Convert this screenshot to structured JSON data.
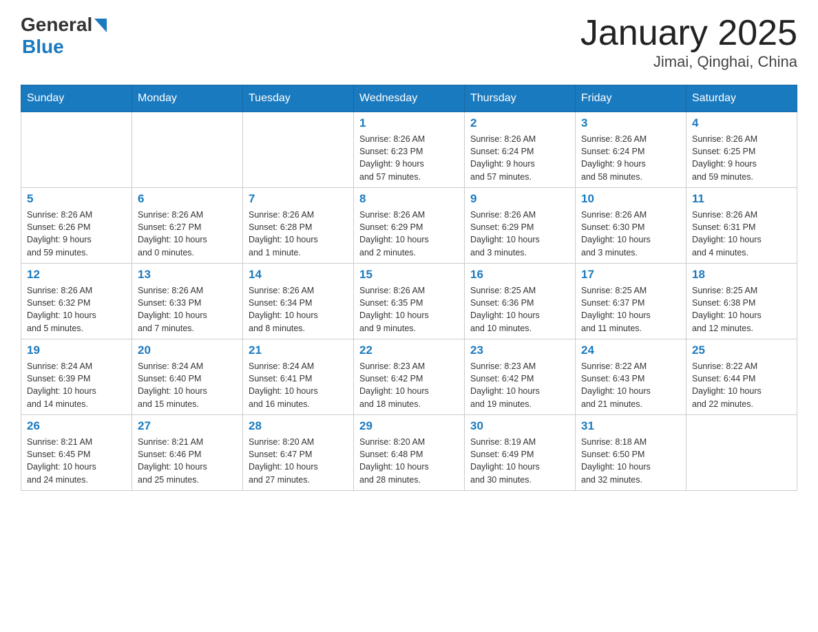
{
  "header": {
    "logo_general": "General",
    "logo_blue": "Blue",
    "title": "January 2025",
    "subtitle": "Jimai, Qinghai, China"
  },
  "days_of_week": [
    "Sunday",
    "Monday",
    "Tuesday",
    "Wednesday",
    "Thursday",
    "Friday",
    "Saturday"
  ],
  "weeks": [
    [
      {
        "day": null,
        "info": null
      },
      {
        "day": null,
        "info": null
      },
      {
        "day": null,
        "info": null
      },
      {
        "day": "1",
        "info": "Sunrise: 8:26 AM\nSunset: 6:23 PM\nDaylight: 9 hours\nand 57 minutes."
      },
      {
        "day": "2",
        "info": "Sunrise: 8:26 AM\nSunset: 6:24 PM\nDaylight: 9 hours\nand 57 minutes."
      },
      {
        "day": "3",
        "info": "Sunrise: 8:26 AM\nSunset: 6:24 PM\nDaylight: 9 hours\nand 58 minutes."
      },
      {
        "day": "4",
        "info": "Sunrise: 8:26 AM\nSunset: 6:25 PM\nDaylight: 9 hours\nand 59 minutes."
      }
    ],
    [
      {
        "day": "5",
        "info": "Sunrise: 8:26 AM\nSunset: 6:26 PM\nDaylight: 9 hours\nand 59 minutes."
      },
      {
        "day": "6",
        "info": "Sunrise: 8:26 AM\nSunset: 6:27 PM\nDaylight: 10 hours\nand 0 minutes."
      },
      {
        "day": "7",
        "info": "Sunrise: 8:26 AM\nSunset: 6:28 PM\nDaylight: 10 hours\nand 1 minute."
      },
      {
        "day": "8",
        "info": "Sunrise: 8:26 AM\nSunset: 6:29 PM\nDaylight: 10 hours\nand 2 minutes."
      },
      {
        "day": "9",
        "info": "Sunrise: 8:26 AM\nSunset: 6:29 PM\nDaylight: 10 hours\nand 3 minutes."
      },
      {
        "day": "10",
        "info": "Sunrise: 8:26 AM\nSunset: 6:30 PM\nDaylight: 10 hours\nand 3 minutes."
      },
      {
        "day": "11",
        "info": "Sunrise: 8:26 AM\nSunset: 6:31 PM\nDaylight: 10 hours\nand 4 minutes."
      }
    ],
    [
      {
        "day": "12",
        "info": "Sunrise: 8:26 AM\nSunset: 6:32 PM\nDaylight: 10 hours\nand 5 minutes."
      },
      {
        "day": "13",
        "info": "Sunrise: 8:26 AM\nSunset: 6:33 PM\nDaylight: 10 hours\nand 7 minutes."
      },
      {
        "day": "14",
        "info": "Sunrise: 8:26 AM\nSunset: 6:34 PM\nDaylight: 10 hours\nand 8 minutes."
      },
      {
        "day": "15",
        "info": "Sunrise: 8:26 AM\nSunset: 6:35 PM\nDaylight: 10 hours\nand 9 minutes."
      },
      {
        "day": "16",
        "info": "Sunrise: 8:25 AM\nSunset: 6:36 PM\nDaylight: 10 hours\nand 10 minutes."
      },
      {
        "day": "17",
        "info": "Sunrise: 8:25 AM\nSunset: 6:37 PM\nDaylight: 10 hours\nand 11 minutes."
      },
      {
        "day": "18",
        "info": "Sunrise: 8:25 AM\nSunset: 6:38 PM\nDaylight: 10 hours\nand 12 minutes."
      }
    ],
    [
      {
        "day": "19",
        "info": "Sunrise: 8:24 AM\nSunset: 6:39 PM\nDaylight: 10 hours\nand 14 minutes."
      },
      {
        "day": "20",
        "info": "Sunrise: 8:24 AM\nSunset: 6:40 PM\nDaylight: 10 hours\nand 15 minutes."
      },
      {
        "day": "21",
        "info": "Sunrise: 8:24 AM\nSunset: 6:41 PM\nDaylight: 10 hours\nand 16 minutes."
      },
      {
        "day": "22",
        "info": "Sunrise: 8:23 AM\nSunset: 6:42 PM\nDaylight: 10 hours\nand 18 minutes."
      },
      {
        "day": "23",
        "info": "Sunrise: 8:23 AM\nSunset: 6:42 PM\nDaylight: 10 hours\nand 19 minutes."
      },
      {
        "day": "24",
        "info": "Sunrise: 8:22 AM\nSunset: 6:43 PM\nDaylight: 10 hours\nand 21 minutes."
      },
      {
        "day": "25",
        "info": "Sunrise: 8:22 AM\nSunset: 6:44 PM\nDaylight: 10 hours\nand 22 minutes."
      }
    ],
    [
      {
        "day": "26",
        "info": "Sunrise: 8:21 AM\nSunset: 6:45 PM\nDaylight: 10 hours\nand 24 minutes."
      },
      {
        "day": "27",
        "info": "Sunrise: 8:21 AM\nSunset: 6:46 PM\nDaylight: 10 hours\nand 25 minutes."
      },
      {
        "day": "28",
        "info": "Sunrise: 8:20 AM\nSunset: 6:47 PM\nDaylight: 10 hours\nand 27 minutes."
      },
      {
        "day": "29",
        "info": "Sunrise: 8:20 AM\nSunset: 6:48 PM\nDaylight: 10 hours\nand 28 minutes."
      },
      {
        "day": "30",
        "info": "Sunrise: 8:19 AM\nSunset: 6:49 PM\nDaylight: 10 hours\nand 30 minutes."
      },
      {
        "day": "31",
        "info": "Sunrise: 8:18 AM\nSunset: 6:50 PM\nDaylight: 10 hours\nand 32 minutes."
      },
      {
        "day": null,
        "info": null
      }
    ]
  ]
}
